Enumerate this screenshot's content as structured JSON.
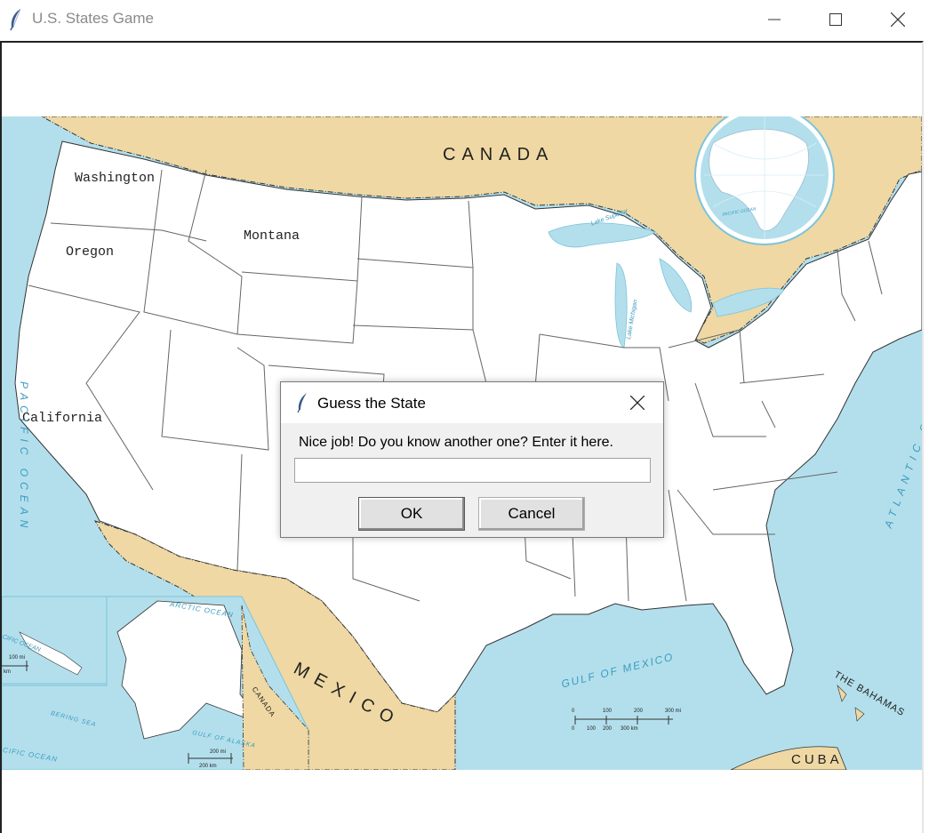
{
  "window": {
    "title": "U.S. States Game",
    "controls": {
      "minimize": "minimize-icon",
      "maximize": "maximize-icon",
      "close": "close-icon"
    }
  },
  "map": {
    "state_labels": [
      "Washington",
      "Oregon",
      "Montana",
      "California"
    ],
    "country_labels": {
      "canada": "CANADA",
      "mexico": "MEXICO",
      "cuba": "CUBA",
      "bahamas": "THE BAHAMAS",
      "canada_small": "CANADA"
    },
    "water_labels": {
      "pacific": "PACIFIC OCEAN",
      "atlantic": "ATLANTIC O",
      "gulf": "GULF OF MEXICO",
      "arctic": "ARCTIC OCEAN",
      "bering": "BERING SEA",
      "gulf_alaska": "GULF OF ALASKA",
      "lake_superior": "Lake Superior",
      "lake_michigan": "Lake Michigan",
      "pacific_small": "CIFIC OCEAN",
      "pacific_inset": "CIFIC OCEAN",
      "globe_pacific": "PACIFIC OCEAN"
    },
    "scale_labels": {
      "main_mi": [
        "0",
        "100",
        "200",
        "300 mi"
      ],
      "main_km": [
        "0",
        "100",
        "200",
        "300 km"
      ],
      "alaska_mi": "200 mi",
      "alaska_km": "200 km",
      "hawaii_mi": "100 mi",
      "hawaii_km": "km"
    },
    "colors": {
      "water": "#b3dfec",
      "land_foreign": "#efd8a3",
      "land_us": "#ffffff",
      "border": "#555555"
    }
  },
  "dialog": {
    "title": "Guess the State",
    "prompt": "Nice job! Do you know another one? Enter it here.",
    "input_value": "",
    "ok_label": "OK",
    "cancel_label": "Cancel",
    "icon": "feather-icon"
  }
}
